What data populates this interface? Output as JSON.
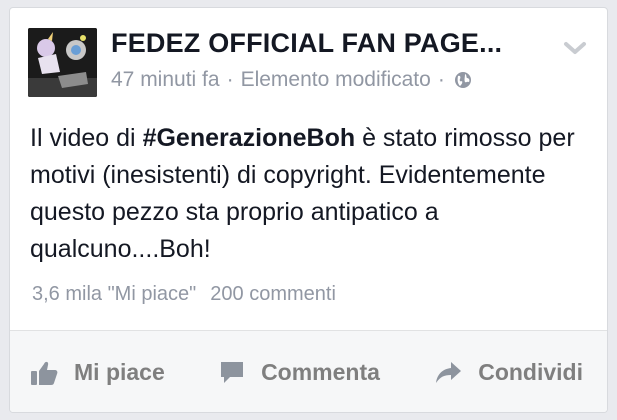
{
  "post": {
    "page_name": "FEDEZ OFFICIAL FAN PAGE...",
    "time": "47 minuti fa",
    "separator": "·",
    "edited": "Elemento modificato",
    "audience_icon": "globe-icon",
    "menu_icon": "chevron-down-icon",
    "text": {
      "part1": "Il video di ",
      "hashtag": "#GenerazioneBoh",
      "part2": " è stato rimosso per motivi (inesistenti) di copyright. Evidentemente questo pezzo sta proprio antipatico a qualcuno....Boh!"
    },
    "likes": "3,6 mila \"Mi piace\"",
    "comments": "200 commenti"
  },
  "actions": {
    "like_label": "Mi piace",
    "like_icon": "thumbs-up-icon",
    "comment_label": "Commenta",
    "comment_icon": "speech-bubble-icon",
    "share_label": "Condividi",
    "share_icon": "share-arrow-icon"
  },
  "colors": {
    "text_primary": "#141823",
    "text_secondary": "#9197a3",
    "action_text": "#7f7f7f",
    "background": "#e9eaee",
    "card": "#ffffff",
    "action_bar": "#f6f7f8"
  }
}
